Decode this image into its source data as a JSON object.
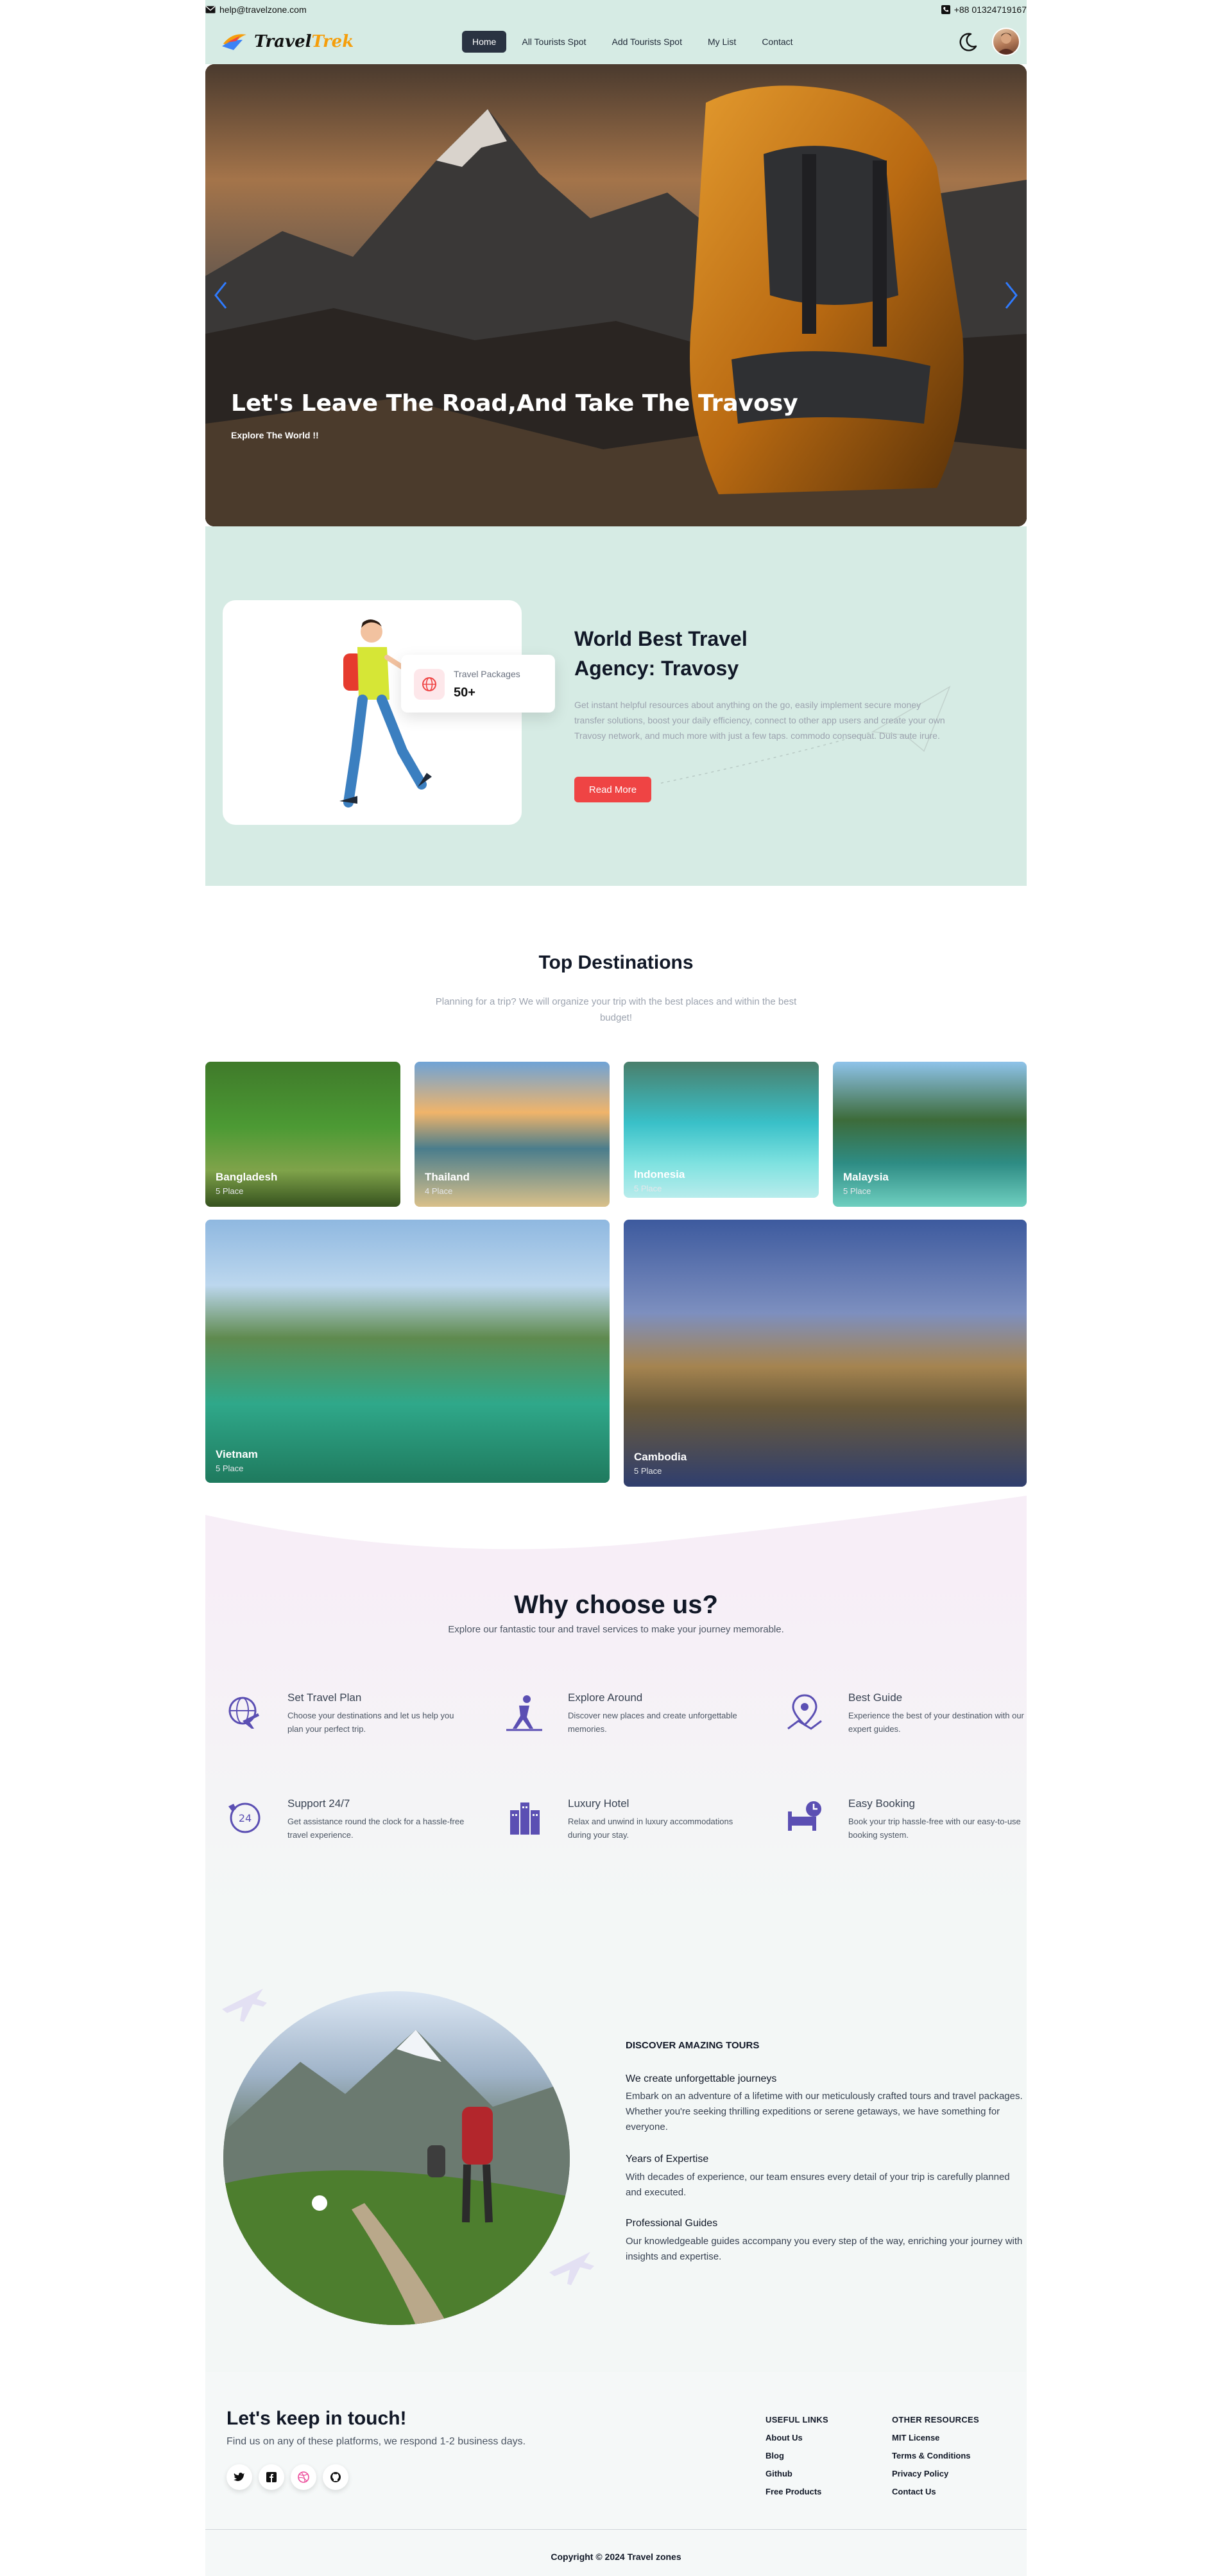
{
  "topbar": {
    "email": "help@travelzone.com",
    "phone": "+88 01324719167"
  },
  "header": {
    "logo": {
      "part1": "Travel",
      "part2": "Trek"
    },
    "nav": [
      "Home",
      "All Tourists Spot",
      "Add Tourists Spot",
      "My List",
      "Contact"
    ],
    "active_nav": "Home"
  },
  "hero": {
    "title": "Let's Leave The Road,And Take The Travosy",
    "subtitle": "Explore The World !!"
  },
  "agency": {
    "package_label": "Travel Packages",
    "package_value": "50+",
    "title": "World Best Travel Agency: Travosy",
    "text": "Get instant helpful resources about anything on the go, easily implement secure money transfer solutions, boost your daily efficiency, connect to other app users and create your own Travosy network, and much more with just a few taps. commodo consequat. Duis aute irure.",
    "button": "Read More"
  },
  "destinations": {
    "title": "Top Destinations",
    "subtitle": "Planning for a trip? We will organize your trip with the best places and within the best budget!",
    "items": [
      {
        "name": "Bangladesh",
        "count": "5 Place"
      },
      {
        "name": "Thailand",
        "count": "4 Place"
      },
      {
        "name": "Indonesia",
        "count": "5 Place"
      },
      {
        "name": "Malaysia",
        "count": "5 Place"
      },
      {
        "name": "Vietnam",
        "count": "5 Place"
      },
      {
        "name": "Cambodia",
        "count": "5 Place"
      }
    ]
  },
  "why": {
    "title": "Why choose us?",
    "subtitle": "Explore our fantastic tour and travel services to make your journey memorable.",
    "features": [
      {
        "icon": "globe-plane-icon",
        "title": "Set Travel Plan",
        "text": "Choose your destinations and let us help you plan your perfect trip."
      },
      {
        "icon": "hiker-icon",
        "title": "Explore Around",
        "text": "Discover new places and create unforgettable memories."
      },
      {
        "icon": "map-pin-icon",
        "title": "Best Guide",
        "text": "Experience the best of your destination with our expert guides."
      },
      {
        "icon": "phone-24-icon",
        "title": "Support 24/7",
        "text": "Get assistance round the clock for a hassle-free travel experience."
      },
      {
        "icon": "hotel-icon",
        "title": "Luxury Hotel",
        "text": "Relax and unwind in luxury accommodations during your stay."
      },
      {
        "icon": "booking-icon",
        "title": "Easy Booking",
        "text": "Book your trip hassle-free with our easy-to-use booking system."
      }
    ]
  },
  "tours": {
    "heading": "DISCOVER AMAZING TOURS",
    "lead_title": "We create unforgettable journeys",
    "lead_text": "Embark on an adventure of a lifetime with our meticulously crafted tours and travel packages. Whether you're seeking thrilling expeditions or serene getaways, we have something for everyone.",
    "h1": "Years of Expertise",
    "p1": "With decades of experience, our team ensures every detail of your trip is carefully planned and executed.",
    "h2": "Professional Guides",
    "p2": "Our knowledgeable guides accompany you every step of the way, enriching your journey with insights and expertise."
  },
  "footer": {
    "title": "Let's keep in touch!",
    "subtitle": "Find us on any of these platforms, we respond 1-2 business days.",
    "useful_heading": "USEFUL LINKS",
    "useful_links": [
      "About Us",
      "Blog",
      "Github",
      "Free Products"
    ],
    "other_heading": "OTHER RESOURCES",
    "other_links": [
      "MIT License",
      "Terms & Conditions",
      "Privacy Policy",
      "Contact Us"
    ],
    "copyright": "Copyright © 2024 Travel zones"
  },
  "colors": {
    "mint": "#d6ebe4",
    "accent": "#ef4444",
    "nav_active": "#2a3342",
    "icon": "#5b4fb3",
    "logo_orange": "#f59e0b"
  }
}
